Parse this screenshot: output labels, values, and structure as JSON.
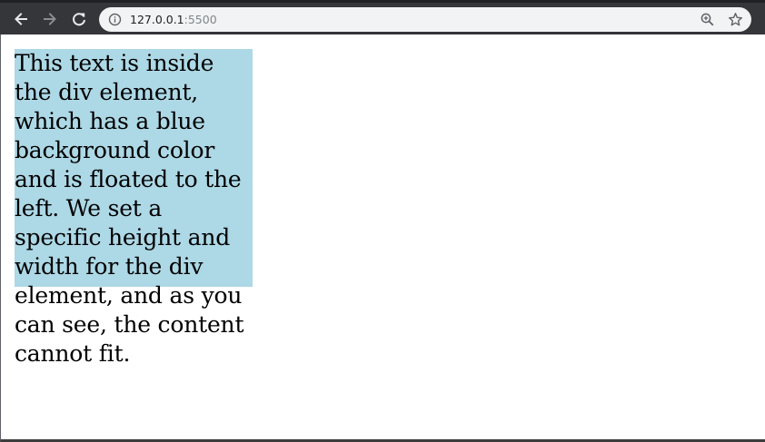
{
  "browser": {
    "url_host": "127.0.0.1",
    "url_port": ":5500",
    "icons": {
      "back": "back-arrow-icon",
      "forward": "forward-arrow-icon",
      "reload": "reload-icon",
      "site_info": "info-icon",
      "zoom": "zoom-icon",
      "bookmark": "star-icon"
    }
  },
  "page": {
    "div_text": "This text is inside the div element, which has a blue background color and is floated to the left. We set a specific height and width for the div element, and as you can see, the content cannot fit.",
    "div_background": "#add8e6"
  }
}
